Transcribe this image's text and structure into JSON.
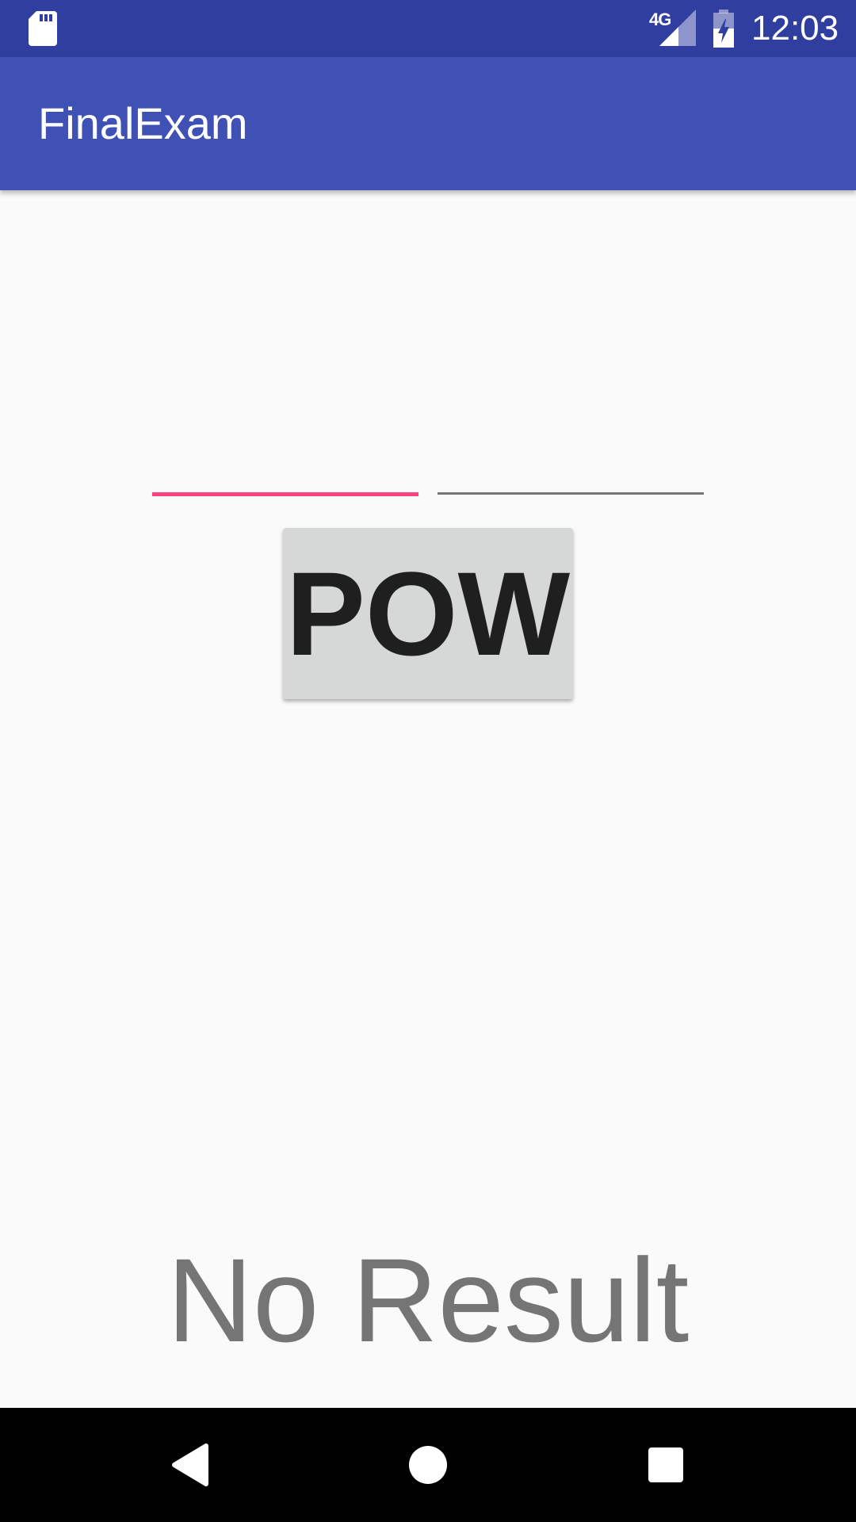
{
  "status_bar": {
    "network_type": "4G",
    "time": "12:03",
    "icons": [
      "sd-card-icon",
      "signal-icon",
      "battery-charging-icon"
    ]
  },
  "app_bar": {
    "title": "FinalExam"
  },
  "form": {
    "input_a": {
      "value": "",
      "placeholder": "",
      "state": "focused"
    },
    "input_b": {
      "value": "",
      "placeholder": "",
      "state": "unfocused"
    },
    "pow_button_label": "POW"
  },
  "result": {
    "text": "No Result"
  },
  "nav_bar": {
    "icons": [
      "back-icon",
      "home-icon",
      "recents-icon"
    ]
  },
  "colors": {
    "status_bar": "#303f9f",
    "app_bar": "#3f51b5",
    "accent": "#ff4081",
    "background": "#fafafa",
    "button": "#d6d7d7",
    "result_text": "#757575"
  }
}
